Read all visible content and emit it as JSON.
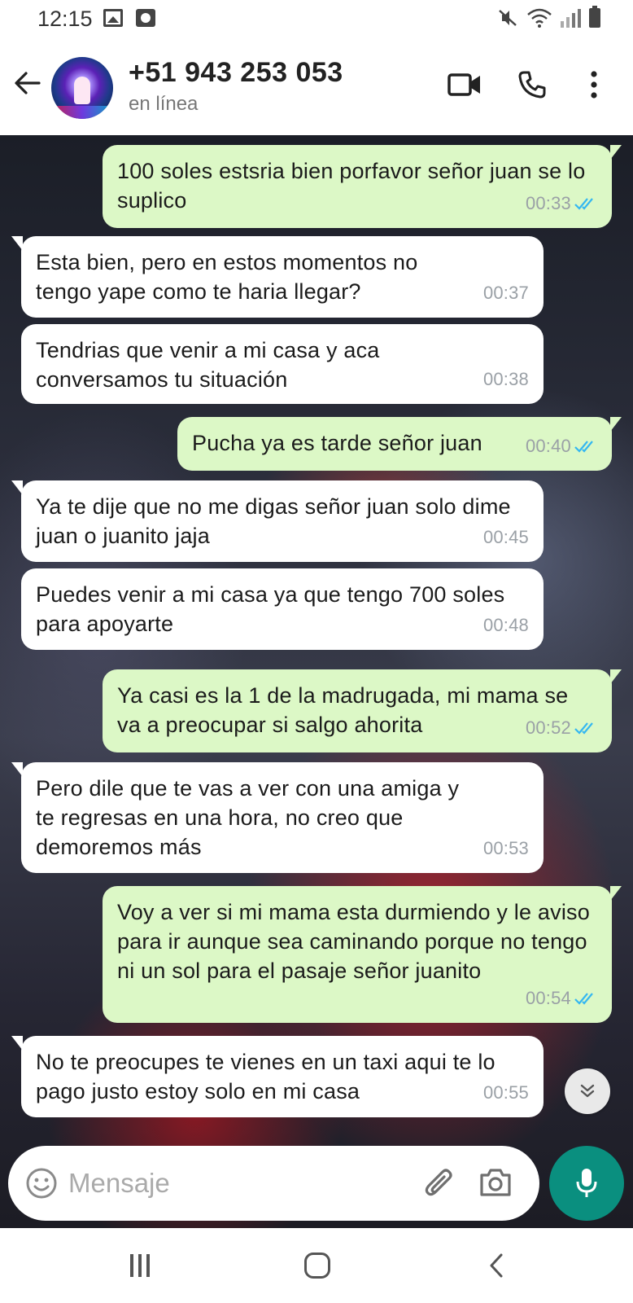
{
  "status_bar": {
    "time": "12:15",
    "icons": [
      "image-icon",
      "screen-record-icon",
      "mute-icon",
      "wifi-icon",
      "signal-icon",
      "battery-icon"
    ]
  },
  "header": {
    "contact_name": "+51 943 253 053",
    "contact_status": "en línea",
    "icons": [
      "back-arrow-icon",
      "avatar",
      "video-call-icon",
      "phone-icon",
      "more-options-icon"
    ]
  },
  "messages": [
    {
      "direction": "out",
      "text": "100 soles estsria bien porfavor señor juan se lo suplico",
      "time": "00:33",
      "read": true
    },
    {
      "direction": "in",
      "text": "Esta bien, pero en estos momentos no tengo yape como te haria llegar?",
      "time": "00:37"
    },
    {
      "direction": "in",
      "text": "Tendrias que venir a mi casa y aca conversamos tu situación",
      "time": "00:38"
    },
    {
      "direction": "out",
      "text": "Pucha ya es tarde señor juan",
      "time": "00:40",
      "read": true
    },
    {
      "direction": "in",
      "text": "Ya te dije que no me digas señor juan solo dime juan o juanito jaja",
      "time": "00:45"
    },
    {
      "direction": "in",
      "text": "Puedes venir a mi casa ya que tengo 700 soles para apoyarte",
      "time": "00:48"
    },
    {
      "direction": "out",
      "text": "Ya casi es la 1 de la madrugada, mi mama se va a preocupar si salgo ahorita",
      "time": "00:52",
      "read": true
    },
    {
      "direction": "in",
      "text": "Pero dile que te vas a ver con una amiga y te regresas en una hora, no creo que demoremos más",
      "time": "00:53"
    },
    {
      "direction": "out",
      "text": "Voy a ver si mi mama esta durmiendo y le aviso para ir aunque sea caminando porque no tengo ni un sol para el pasaje señor juanito",
      "time": "00:54",
      "read": true
    },
    {
      "direction": "in",
      "text": "No te preocupes te vienes en un taxi aqui te lo pago justo estoy solo en mi casa",
      "time": "00:55"
    }
  ],
  "composer": {
    "placeholder": "Mensaje"
  },
  "colors": {
    "outgoing_bubble": "#dcf8c6",
    "incoming_bubble": "#ffffff",
    "read_ticks": "#34b7f1",
    "mic_button": "#0a8f7f"
  }
}
